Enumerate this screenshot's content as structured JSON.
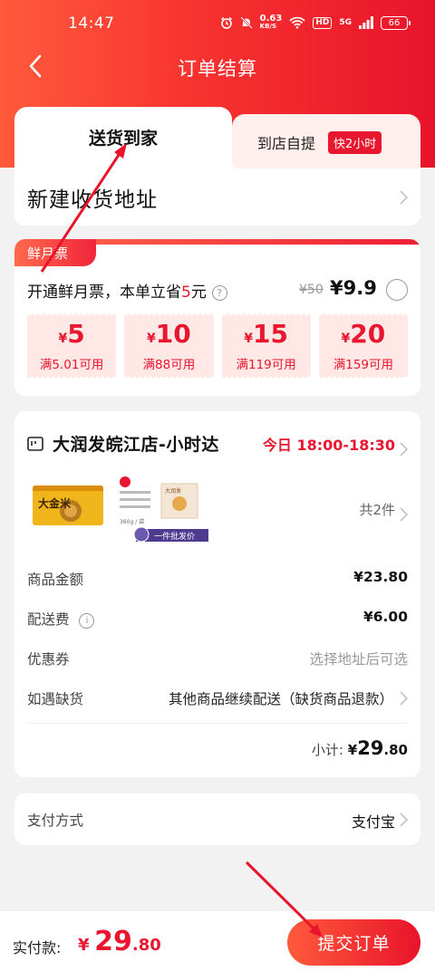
{
  "status_bar": {
    "time": "14:47",
    "network_speed": "0.63",
    "network_unit": "KB/S",
    "hd": "HD",
    "signal_type": "5G",
    "battery": "66"
  },
  "nav": {
    "title": "订单结算"
  },
  "delivery": {
    "tab_home": "送货到家",
    "tab_store": "到店自提",
    "tab_store_badge": "快2小时",
    "address_label": "新建收货地址"
  },
  "coupon": {
    "tag": "鲜月票",
    "title_prefix": "开通鲜月票，本单立省",
    "title_save": "5",
    "title_suffix": "元",
    "info_icon": "?",
    "price_old": "¥50",
    "price_new": "¥9.9",
    "currency": "¥",
    "vouchers": [
      {
        "amount": "5",
        "condition": "满5.01可用"
      },
      {
        "amount": "10",
        "condition": "满88可用"
      },
      {
        "amount": "15",
        "condition": "满119可用"
      },
      {
        "amount": "20",
        "condition": "满159可用"
      }
    ]
  },
  "store": {
    "name": "大润发皖江店-小时达",
    "delivery_time": "今日 18:00-18:30",
    "item_count": "共2件",
    "product1_text": "大金米",
    "product2_banner": "一件批发价",
    "product2_weight": "360g / 袋",
    "product2_brand": "大润发",
    "rows": {
      "goods_label": "商品金额",
      "goods_value": "¥23.80",
      "shipping_label": "配送费",
      "shipping_info_icon": "i",
      "shipping_value": "¥6.00",
      "coupon_label": "优惠券",
      "coupon_value": "选择地址后可选",
      "shortage_label": "如遇缺货",
      "shortage_value": "其他商品继续配送（缺货商品退款）"
    },
    "subtotal_label": "小计:",
    "subtotal_yen": "¥",
    "subtotal_int": "29",
    "subtotal_dec": ".80"
  },
  "payment": {
    "label": "支付方式",
    "value": "支付宝"
  },
  "bottom": {
    "total_label": "实付款:",
    "total_yen": "¥",
    "total_int": "29",
    "total_dec": ".80",
    "submit": "提交订单"
  },
  "colors": {
    "brand_red": "#e8172f",
    "header_gradient_start": "#ff5a3c",
    "voucher_bg": "#ffe8e6",
    "annotation_arrow": "#e8142b"
  }
}
